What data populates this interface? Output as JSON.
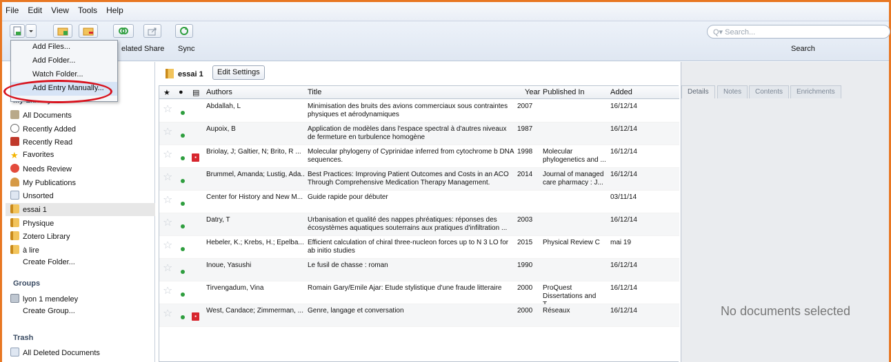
{
  "menubar": {
    "items": [
      "File",
      "Edit",
      "View",
      "Tools",
      "Help"
    ]
  },
  "toolbar": {
    "labels": [
      "elated",
      "Share",
      "Sync"
    ],
    "search_placeholder": "Q▾ Search...",
    "search_label": "Search"
  },
  "dropdown": {
    "items": [
      "Add Files...",
      "Add Folder...",
      "Watch Folder...",
      "Add Entry Manually..."
    ]
  },
  "sidebar": {
    "my_library_heading": "My Library",
    "items": [
      {
        "label": "All Documents",
        "icon": "docs"
      },
      {
        "label": "Recently Added",
        "icon": "clock"
      },
      {
        "label": "Recently Read",
        "icon": "book"
      },
      {
        "label": "Favorites",
        "icon": "star"
      },
      {
        "label": "Needs Review",
        "icon": "review"
      },
      {
        "label": "My Publications",
        "icon": "person"
      },
      {
        "label": "Unsorted",
        "icon": "unsorted"
      },
      {
        "label": "essai 1",
        "icon": "folder"
      },
      {
        "label": "Physique",
        "icon": "folder"
      },
      {
        "label": "Zotero Library",
        "icon": "folder"
      },
      {
        "label": "à lire",
        "icon": "folder"
      },
      {
        "label": "Create Folder...",
        "icon": "none"
      }
    ],
    "groups_heading": "Groups",
    "groups": [
      {
        "label": "lyon 1 mendeley",
        "icon": "group"
      },
      {
        "label": "Create Group...",
        "icon": "none"
      }
    ],
    "trash_heading": "Trash",
    "trash": [
      {
        "label": "All Deleted Documents",
        "icon": "trash"
      }
    ]
  },
  "collection": {
    "title": "essai 1",
    "edit_button": "Edit Settings"
  },
  "table": {
    "headers": {
      "authors": "Authors",
      "title": "Title",
      "year": "Year",
      "published_in": "Published In",
      "added": "Added"
    },
    "rows": [
      {
        "authors": "Abdallah, L",
        "title": "Minimisation des bruits des avions commerciaux sous contraintes physiques et aérodynamiques",
        "year": "2007",
        "published": "",
        "added": "16/12/14",
        "pdf": false
      },
      {
        "authors": "Aupoix, B",
        "title": "Application de modèles dans l'espace spectral à d'autres niveaux de fermeture en turbulence homogène",
        "year": "1987",
        "published": "",
        "added": "16/12/14",
        "pdf": false
      },
      {
        "authors": "Briolay, J; Galtier, N; Brito, R ...",
        "title": "Molecular phylogeny of Cyprinidae inferred from cytochrome b DNA sequences.",
        "year": "1998",
        "published": "Molecular phylogenetics and ...",
        "added": "16/12/14",
        "pdf": true
      },
      {
        "authors": "Brummel, Amanda; Lustig, Ada...",
        "title": "Best Practices: Improving Patient Outcomes and Costs in an ACO Through Comprehensive Medication Therapy Management.",
        "year": "2014",
        "published": "Journal of managed care pharmacy : J...",
        "added": "16/12/14",
        "pdf": false
      },
      {
        "authors": "Center for History and New M...",
        "title": "Guide rapide pour débuter",
        "year": "",
        "published": "",
        "added": "03/11/14",
        "pdf": false
      },
      {
        "authors": "Datry, T",
        "title": "Urbanisation et qualité des nappes phréatiques: réponses des écosystèmes aquatiques souterrains aux pratiques d'infiltration ...",
        "year": "2003",
        "published": "",
        "added": "16/12/14",
        "pdf": false
      },
      {
        "authors": "Hebeler, K.; Krebs, H.; Epelba...",
        "title": "Efficient calculation of chiral three-nucleon forces up to N 3 LO for ab initio studies",
        "year": "2015",
        "published": "Physical Review C",
        "added": "mai 19",
        "pdf": false
      },
      {
        "authors": "Inoue, Yasushi",
        "title": "Le fusil de chasse : roman",
        "year": "1990",
        "published": "",
        "added": "16/12/14",
        "pdf": false
      },
      {
        "authors": "Tirvengadum, Vina",
        "title": "Romain Gary/Emile Ajar: Etude stylistique d'une fraude litteraire",
        "year": "2000",
        "published": "ProQuest Dissertations and T...",
        "added": "16/12/14",
        "pdf": false
      },
      {
        "authors": "West, Candace; Zimmerman, ...",
        "title": "Genre, langage et conversation",
        "year": "2000",
        "published": "Réseaux",
        "added": "16/12/14",
        "pdf": true
      }
    ]
  },
  "details": {
    "tabs": [
      "Details",
      "Notes",
      "Contents",
      "Enrichments"
    ],
    "empty_message": "No documents selected"
  },
  "colors": {
    "accent": "#e87722",
    "annotation": "#d8121d",
    "read_dot": "#2e9e3e",
    "pdf": "#d7262e"
  }
}
